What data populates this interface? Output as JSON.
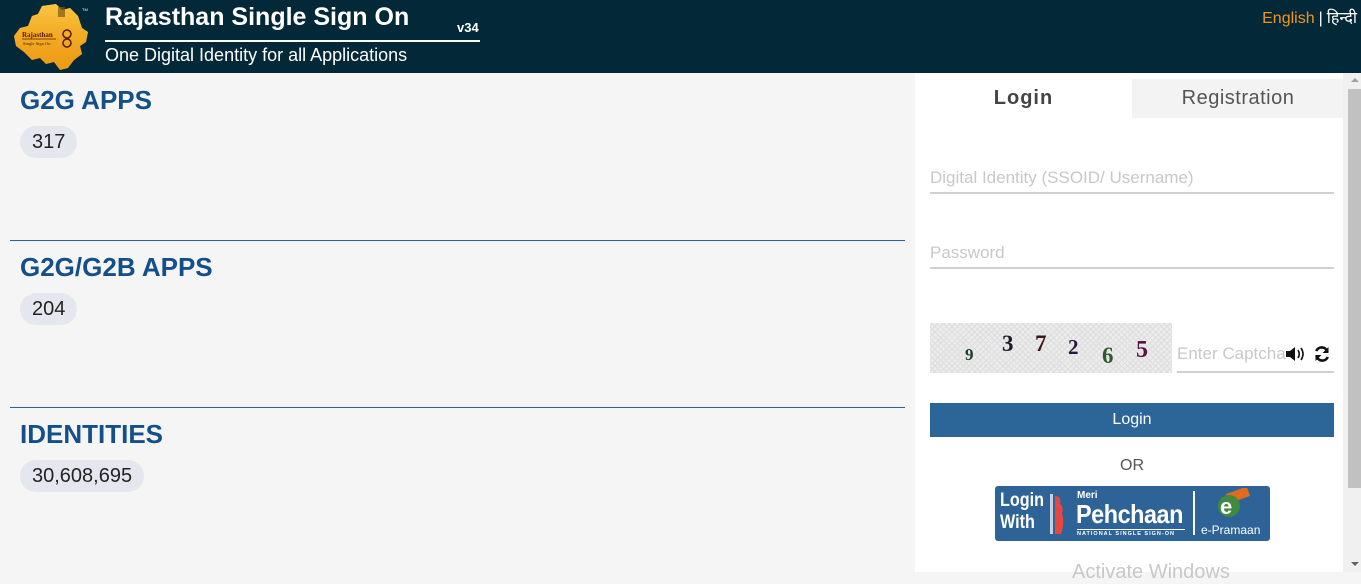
{
  "header": {
    "title": "Rajasthan Single Sign On",
    "version": "v34",
    "subtitle": "One Digital Identity for all Applications",
    "logo_text": "Rajasthan Single Sign On",
    "lang_english": "English",
    "lang_separator": "|",
    "lang_hindi": "हिन्दी"
  },
  "stats": [
    {
      "title": "G2G APPS",
      "value": "317"
    },
    {
      "title": "G2G/G2B APPS",
      "value": "204"
    },
    {
      "title": "IDENTITIES",
      "value": "30,608,695"
    }
  ],
  "login_panel": {
    "tabs": [
      {
        "label": "Login",
        "active": true
      },
      {
        "label": "Registration",
        "active": false
      }
    ],
    "username_placeholder": "Digital Identity (SSOID/ Username)",
    "username_value": "",
    "password_placeholder": "Password",
    "password_value": "",
    "captcha_digits": [
      "9",
      "3",
      "7",
      "2",
      "6",
      "5"
    ],
    "captcha_placeholder": "Enter Captcha",
    "captcha_value": "",
    "audio_icon": "speaker-icon",
    "refresh_icon": "refresh-icon",
    "login_button": "Login",
    "or_text": "OR",
    "meri_pehchaan": {
      "login_with": "Login With",
      "meri": "Meri",
      "pehchaan": "Pehchaan",
      "tagline": "NATIONAL SINGLE SIGN-ON",
      "epramaan": "e-Pramaan"
    },
    "watermark": "Activate Windows"
  },
  "colors": {
    "header_bg": "#032838",
    "accent_orange": "#f7941d",
    "title_blue": "#134f8a",
    "button_blue": "#2c6699"
  }
}
